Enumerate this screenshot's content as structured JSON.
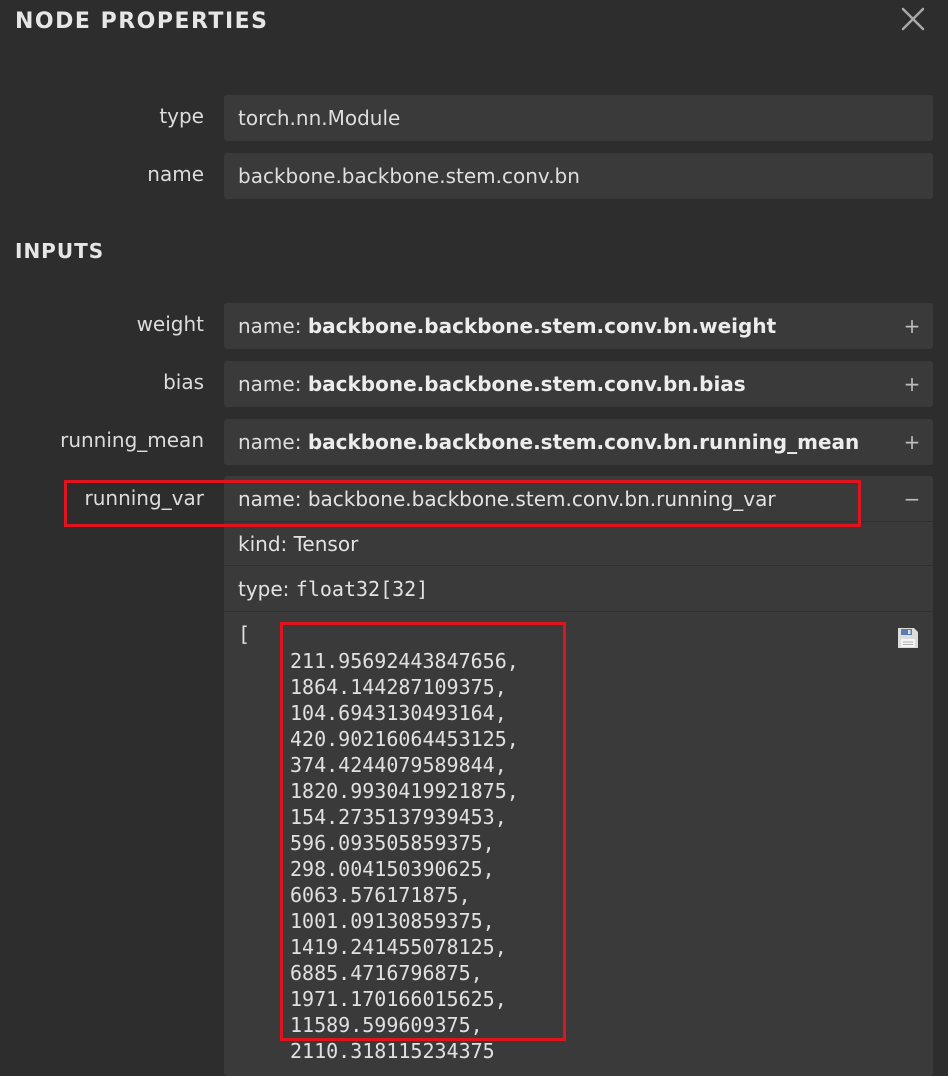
{
  "panel": {
    "title": "NODE PROPERTIES",
    "close_icon": "close-icon"
  },
  "node": {
    "type_label": "type",
    "type_value": "torch.nn.Module",
    "name_label": "name",
    "name_value": "backbone.backbone.stem.conv.bn"
  },
  "inputs": {
    "title": "INPUTS",
    "items": [
      {
        "label": "weight",
        "key": "name: ",
        "value": "backbone.backbone.stem.conv.bn.weight",
        "toggle": "+"
      },
      {
        "label": "bias",
        "key": "name: ",
        "value": "backbone.backbone.stem.conv.bn.bias",
        "toggle": "+"
      },
      {
        "label": "running_mean",
        "key": "name: ",
        "value": "backbone.backbone.stem.conv.bn.running_mean",
        "toggle": "+"
      },
      {
        "label": "running_var",
        "key": "name: ",
        "value": "backbone.backbone.stem.conv.bn.running_var",
        "toggle": "−"
      }
    ],
    "expanded": {
      "kind_key": "kind: ",
      "kind_value": "Tensor",
      "type_key": "type: ",
      "type_value": "float32[32]",
      "open_bracket": "[",
      "save_icon": "save-icon",
      "values": [
        "211.95692443847656,",
        "1864.144287109375,",
        "104.6943130493164,",
        "420.90216064453125,",
        "374.4244079589844,",
        "1820.9930419921875,",
        "154.2735137939453,",
        "596.093505859375,",
        "298.004150390625,",
        "6063.576171875,",
        "1001.09130859375,",
        "1419.241455078125,",
        "6885.4716796875,",
        "1971.170166015625,",
        "11589.599609375,",
        "2110.318115234375"
      ]
    }
  },
  "colors": {
    "background": "#2d2d2d",
    "field": "#3a3a3a",
    "highlight": "#e0141e"
  }
}
